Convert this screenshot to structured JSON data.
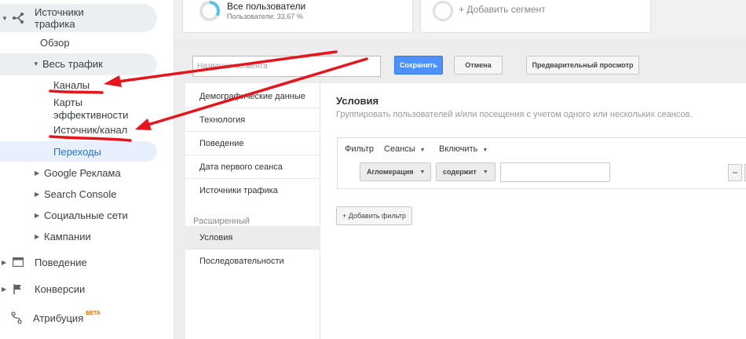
{
  "sidebar": {
    "acquisition": "Источники трафика",
    "overview": "Обзор",
    "all_traffic": "Весь трафик",
    "channels": "Каналы",
    "treemaps": "Карты эффективности",
    "source_medium": "Источник/канал",
    "referrals": "Переходы",
    "google_ads": "Google Реклама",
    "search_console": "Search Console",
    "social": "Социальные сети",
    "campaigns": "Кампании",
    "behavior": "Поведение",
    "conversions": "Конверсии",
    "attribution": "Атрибуция",
    "beta": "БЕТА"
  },
  "segments": {
    "all_users": "Все пользователи",
    "all_users_sub": "Пользователи: 33,67 %",
    "all_users_fraction": 0.3367,
    "add_segment": "+ Добавить сегмент"
  },
  "builder": {
    "name_placeholder": "Название сегмента",
    "save": "Сохранить",
    "cancel": "Отмена",
    "preview": "Предварительный просмотр"
  },
  "categories": {
    "items": [
      "Демографические данные",
      "Технология",
      "Поведение",
      "Дата первого сеанса",
      "Источники трафика"
    ],
    "advanced_title": "Расширенный",
    "advanced": [
      "Условия",
      "Последовательности"
    ]
  },
  "conditions": {
    "title": "Условия",
    "description": "Группировать пользователей и/или посещения с учетом одного или нескольких сеансов.",
    "filter": "Фильтр",
    "sessions": "Сеансы",
    "include": "Включить",
    "dimension": "Агломерация",
    "operator": "содержит",
    "value": "",
    "minus": "−",
    "add_filter": "+ Добавить фильтр"
  },
  "colors": {
    "accent_blue": "#1a73e8",
    "save_blue": "#4d90fe",
    "annotation_red": "#e8141c",
    "ring_blue": "#4fc3f7"
  }
}
